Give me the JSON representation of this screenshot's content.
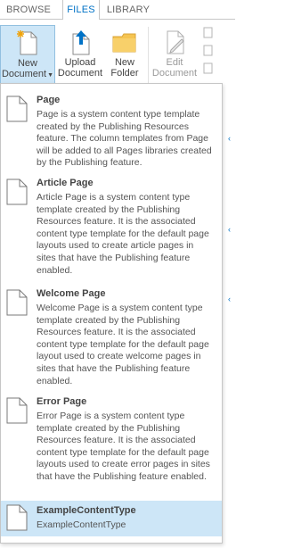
{
  "tabs": [
    {
      "label": "BROWSE"
    },
    {
      "label": "FILES"
    },
    {
      "label": "LIBRARY"
    }
  ],
  "ribbon": {
    "new_document": {
      "line1": "New",
      "line2": "Document"
    },
    "upload_document": {
      "line1": "Upload",
      "line2": "Document"
    },
    "new_folder": {
      "line1": "New",
      "line2": "Folder"
    },
    "edit_document": {
      "line1": "Edit",
      "line2": "Document"
    }
  },
  "menu": {
    "items": [
      {
        "title": "Page",
        "description": "Page is a system content type template created by the Publishing Resources feature. The column templates from Page will be added to all Pages libraries created by the Publishing feature."
      },
      {
        "title": "Article Page",
        "description": "Article Page is a system content type template created by the Publishing Resources feature. It is the associated content type template for the default page layouts used to create article pages in sites that have the Publishing feature enabled."
      },
      {
        "title": "Welcome Page",
        "description": "Welcome Page is a system content type template created by the Publishing Resources feature. It is the associated content type template for the default page layout used to create welcome pages in sites that have the Publishing feature enabled."
      },
      {
        "title": "Error Page",
        "description": "Error Page is a system content type template created by the Publishing Resources feature. It is the associated content type template for the default page layouts used to create error pages in sites that have the Publishing feature enabled."
      },
      {
        "title": "ExampleContentType",
        "description": "ExampleContentType"
      }
    ]
  },
  "colors": {
    "accent": "#0072c6",
    "hover": "#cde6f7"
  }
}
